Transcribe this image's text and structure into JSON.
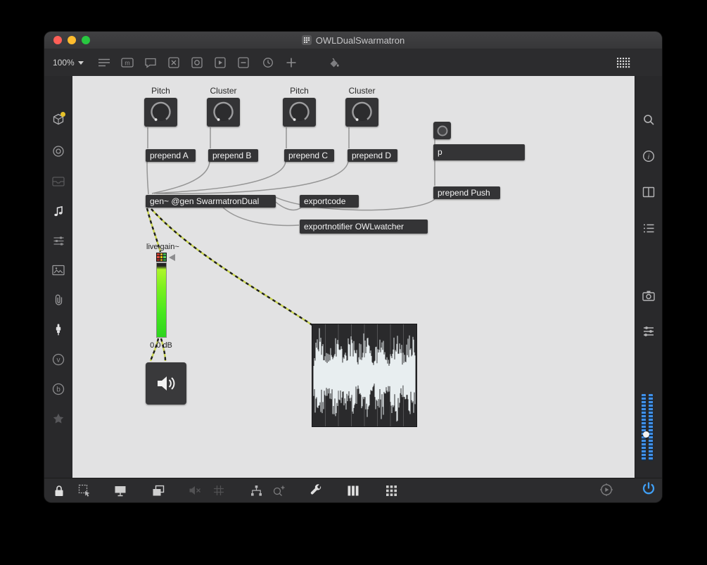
{
  "titlebar": {
    "title": "OWLDualSwarmatron"
  },
  "toolbar": {
    "zoom_level": "100%"
  },
  "patch": {
    "knob_labels": [
      "Pitch",
      "Cluster",
      "Pitch",
      "Cluster"
    ],
    "prepend_labels": [
      "prepend A",
      "prepend B",
      "prepend C",
      "prepend D"
    ],
    "p_object_label": "p",
    "prepend_push_label": "prepend Push",
    "gen_label": "gen~ @gen SwarmatronDual",
    "exportcode_label": "exportcode",
    "exportnotifier_label": "exportnotifier OWLwatcher",
    "live_gain_label": "live.gain~",
    "gain_value": "0.0 dB"
  },
  "icons": {
    "patcher-doc-icon": "dot-grid-square",
    "zoom-caret-icon": "triangle-down",
    "patcher-list-icon": "list-lines",
    "max-object-icon": "box-m",
    "comment-icon": "speech-bubble",
    "x-box-icon": "box-with-x",
    "circle-box-icon": "box-with-circle",
    "playbar-box-icon": "box-with-play",
    "minus-box-icon": "box-with-minus",
    "clock-icon": "clock",
    "add-object-icon": "plus",
    "paint-bucket-icon": "paint-bucket",
    "grid-browser-icon": "dot-grid",
    "packages-icon": "cube-with-badge",
    "target-icon": "concentric-circles",
    "drawer-icon": "drawer",
    "audio-note-icon": "music-note",
    "mixer-icon": "slider-rows",
    "images-icon": "picture",
    "attachments-icon": "paperclip",
    "plug-icon": "audio-plug",
    "vimeo-icon": "circle-v",
    "bandcamp-icon": "circle-b",
    "favorites-star-icon": "star",
    "search-icon": "magnifier",
    "info-icon": "circle-i",
    "reference-icon": "open-book",
    "console-list-icon": "list",
    "snapshot-camera-icon": "camera",
    "filters-icon": "sliders",
    "lock-icon": "padlock",
    "selection-icon": "selection-arrow",
    "presentation-icon": "screen",
    "layers-icon": "stacked-rects",
    "audio-mute-icon": "speaker-muted",
    "grid-snap-icon": "grid",
    "hierarchy-icon": "node-tree",
    "snippets-icon": "lasso-plus",
    "wrench-icon": "wrench",
    "keyboard-piano-icon": "piano-keys",
    "keypad-grid-icon": "button-grid",
    "transport-play-icon": "circle-play",
    "audio-power-icon": "power",
    "speaker-icon": "loudspeaker",
    "toggle-circle-icon": "circle",
    "gain-triangle-icon": "triangle-left",
    "knob-arc": "dial-arc"
  },
  "colors": {
    "canvas_bg": "#e2e2e3",
    "object_bg": "#343436",
    "object_text": "#f4f4f4",
    "patch_cord": "#8f8f8f",
    "signal_cord_yellow": "#c9d44e",
    "signal_cord_dark": "#1e1e1e",
    "meter_green_top": "#aef52c",
    "meter_green_bottom": "#2ed41f",
    "accent_blue": "#3f9ef4",
    "traffic_close": "#ff5f57",
    "traffic_minimize": "#febc2e",
    "traffic_zoom": "#28c840",
    "badge_yellow": "#e6c229"
  }
}
